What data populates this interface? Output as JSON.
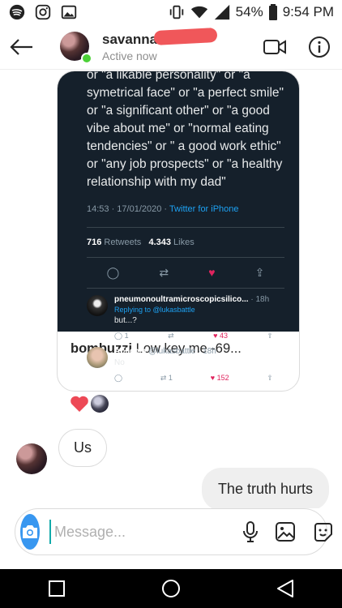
{
  "status_bar": {
    "battery": "54%",
    "time": "9:54 PM"
  },
  "header": {
    "contact_name": "savannah",
    "presence": "Active now"
  },
  "shared_tweet": {
    "text": "or \"a likable personality\" or \"a symetrical face\" or \"a perfect smile\" or \"a significant other\" or \"a good vibe about me\" or \"normal eating tendencies\" or \" a good work ethic\" or \"any job prospects\" or \"a healthy relationship with my dad\"",
    "timestamp": "14:53 · 17/01/2020 · ",
    "source": "Twitter for iPhone",
    "retweets": "716",
    "retweets_label": "Retweets",
    "likes": "4.343",
    "likes_label": "Likes",
    "replies": [
      {
        "name": "pneumonoultramicroscopicsilico...",
        "time": "· 18h",
        "replying_to": "Replying to @lukasbattle",
        "text": "but...?",
        "reply_count": "1",
        "retweet_count": "",
        "like_count": "43"
      },
      {
        "name": "Aol.com",
        "handle": "@lukasbattle · 18h",
        "text": "No",
        "reply_count": "",
        "retweet_count": "1",
        "like_count": "152"
      }
    ]
  },
  "caption": {
    "author": "bombuzzi",
    "text": " Low key me -69..."
  },
  "messages": {
    "incoming": "Us",
    "outgoing": "The truth hurts"
  },
  "composer": {
    "placeholder": "Message..."
  },
  "colors": {
    "accent": "#3897f0",
    "online": "#4cd137",
    "heart": "#ed4956",
    "tweet_bg": "#15202b"
  }
}
